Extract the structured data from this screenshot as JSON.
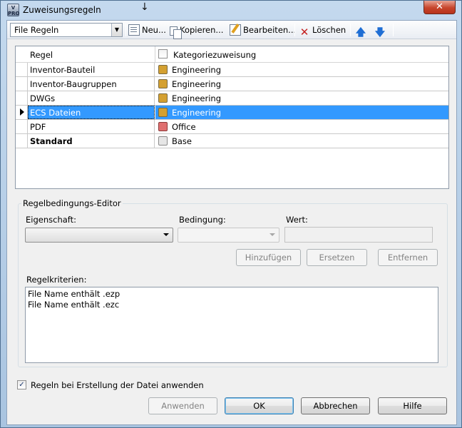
{
  "window": {
    "title": "Zuweisungsregeln",
    "app_icon_text": "V PRO",
    "close_glyph": "✕",
    "cursor_glyph": "↓"
  },
  "toolbar": {
    "combo_value": "File Regeln",
    "new_label": "Neu...",
    "copy_label": "Kopieren...",
    "edit_label": "Bearbeiten...",
    "delete_label": "Löschen",
    "icons": [
      "new-icon",
      "copy-icon",
      "edit-icon",
      "delete-icon",
      "arrow-up-icon",
      "arrow-down-icon"
    ]
  },
  "grid": {
    "headers": {
      "regel": "Regel",
      "kategorie": "Kategoriezuweisung"
    },
    "rows": [
      {
        "regel": "Inventor-Bauteil",
        "kategorie": "Engineering",
        "color": "#d4a030"
      },
      {
        "regel": "Inventor-Baugruppen",
        "kategorie": "Engineering",
        "color": "#d4a030"
      },
      {
        "regel": "DWGs",
        "kategorie": "Engineering",
        "color": "#d4a030"
      },
      {
        "regel": "ECS Dateien",
        "kategorie": "Engineering",
        "color": "#d4a030",
        "selected": true
      },
      {
        "regel": "PDF",
        "kategorie": "Office",
        "color": "#e07070"
      },
      {
        "regel": "Standard",
        "kategorie": "Base",
        "color": "#e6e6e6",
        "bold": true
      }
    ],
    "selection_color": "#3399ff"
  },
  "editor": {
    "group_title": "Regelbedingungs-Editor",
    "eigenschaft_label": "Eigenschaft:",
    "bedingung_label": "Bedingung:",
    "wert_label": "Wert:",
    "add_label": "Hinzufügen",
    "replace_label": "Ersetzen",
    "remove_label": "Entfernen",
    "criteria_label": "Regelkriterien:",
    "criteria": [
      "File Name enthält .ezp",
      "File Name enthält .ezc"
    ]
  },
  "footer": {
    "checkbox_label": "Regeln bei Erstellung der Datei anwenden",
    "checkbox_checked": true,
    "apply_label": "Anwenden",
    "ok_label": "OK",
    "cancel_label": "Abbrechen",
    "help_label": "Hilfe"
  }
}
